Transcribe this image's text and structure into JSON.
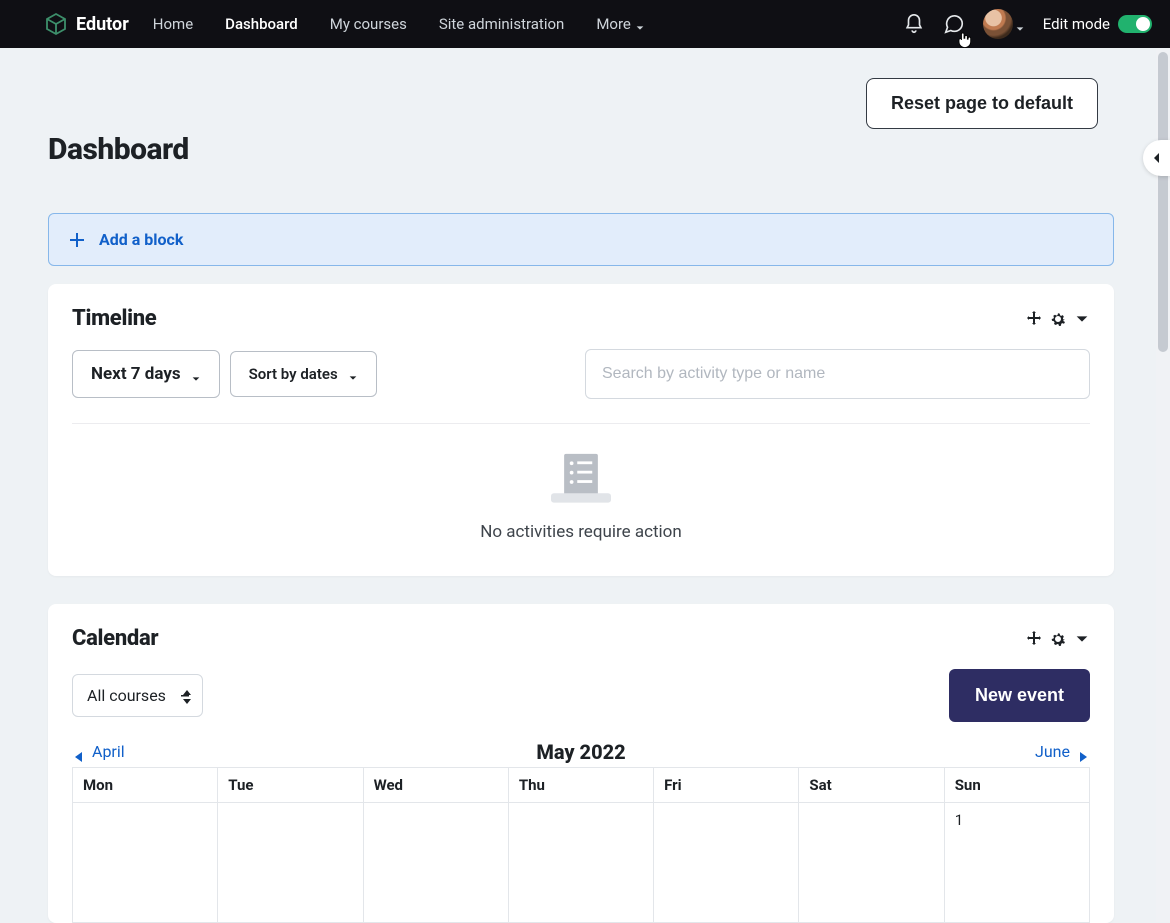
{
  "brand": {
    "name": "Edutor"
  },
  "nav": {
    "links": [
      "Home",
      "Dashboard",
      "My courses",
      "Site administration"
    ],
    "more": "More",
    "activeIndex": 1
  },
  "editMode": {
    "label": "Edit mode",
    "on": true
  },
  "resetButton": "Reset page to default",
  "pageTitle": "Dashboard",
  "addBlock": {
    "label": "Add a block"
  },
  "timeline": {
    "title": "Timeline",
    "rangeButton": "Next 7 days",
    "sortButton": "Sort by dates",
    "searchPlaceholder": "Search by activity type or name",
    "emptyText": "No activities require action"
  },
  "calendar": {
    "title": "Calendar",
    "courseSelect": "All courses",
    "newEvent": "New event",
    "prevMonth": "April",
    "currentMonth": "May 2022",
    "nextMonth": "June",
    "weekdays": [
      "Mon",
      "Tue",
      "Wed",
      "Thu",
      "Fri",
      "Sat",
      "Sun"
    ],
    "firstVisibleDay": "1"
  }
}
